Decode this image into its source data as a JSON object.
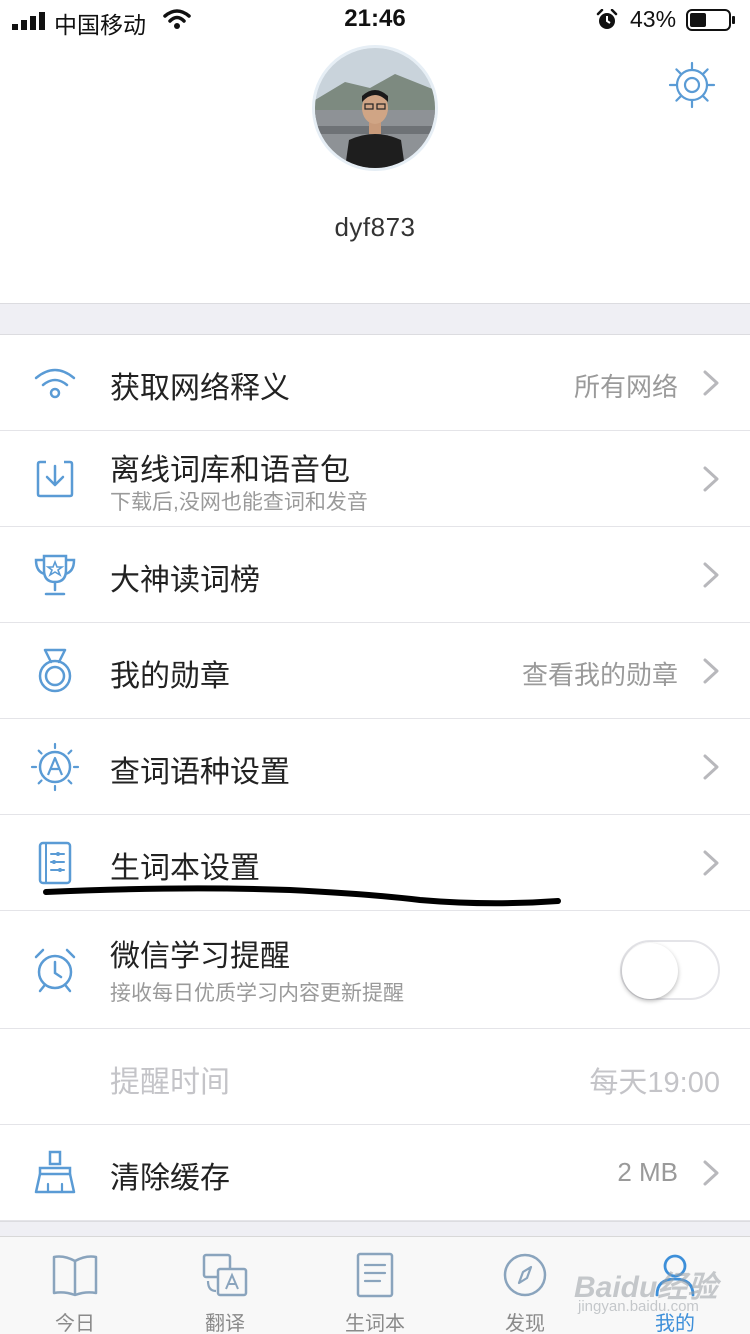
{
  "status_bar": {
    "carrier": "中国移动",
    "time": "21:46",
    "battery_percent": "43%",
    "battery_level": 0.43,
    "icons": [
      "signal-icon",
      "wifi-icon",
      "alarm-icon",
      "battery-icon"
    ]
  },
  "profile": {
    "username": "dyf873",
    "settings_icon": "gear-icon"
  },
  "menu": {
    "items": [
      {
        "label": "获取网络释义",
        "value": "所有网络",
        "icon": "wifi-icon"
      },
      {
        "label": "离线词库和语音包",
        "sub": "下载后,没网也能查词和发音",
        "icon": "download-icon"
      },
      {
        "label": "大神读词榜",
        "icon": "trophy-icon"
      },
      {
        "label": "我的勋章",
        "value": "查看我的勋章",
        "icon": "medal-icon"
      },
      {
        "label": "查词语种设置",
        "icon": "language-icon"
      },
      {
        "label": "生词本设置",
        "icon": "notebook-icon"
      },
      {
        "label": "微信学习提醒",
        "sub": "接收每日优质学习内容更新提醒",
        "icon": "alarm-clock-icon",
        "toggle_on": false
      },
      {
        "label": "提醒时间",
        "value": "每天19:00",
        "disabled": true
      },
      {
        "label": "清除缓存",
        "value": "2 MB",
        "icon": "broom-icon"
      }
    ]
  },
  "tabbar": {
    "tabs": [
      {
        "label": "今日",
        "icon": "book-icon"
      },
      {
        "label": "翻译",
        "icon": "translate-icon"
      },
      {
        "label": "生词本",
        "icon": "wordbook-icon"
      },
      {
        "label": "发现",
        "icon": "compass-icon"
      },
      {
        "label": "我的",
        "icon": "person-icon",
        "active": true
      }
    ]
  },
  "watermark": {
    "text": "Baidu经验",
    "sub": "jingyan.baidu.com"
  },
  "colors": {
    "accent": "#3d8fd9",
    "icon_blue": "#5a9bd5",
    "separator": "#efeff4"
  }
}
